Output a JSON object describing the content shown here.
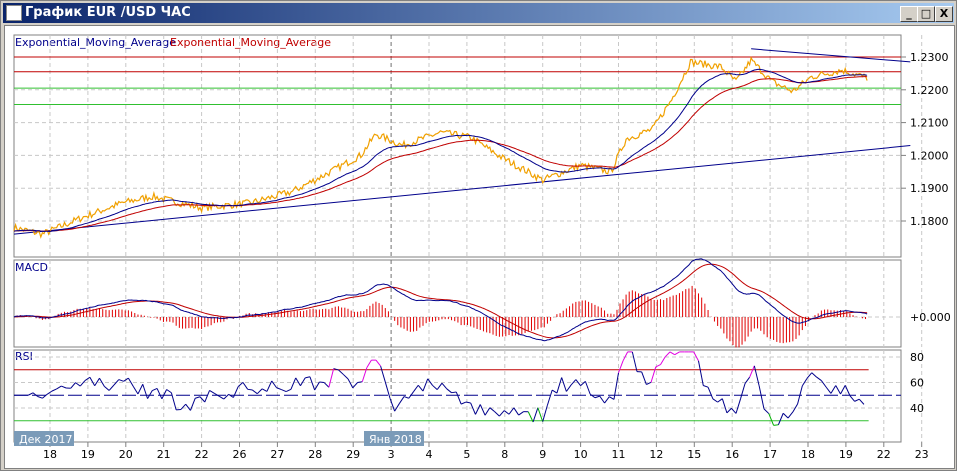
{
  "window": {
    "title": "График EUR /USD  ЧАС",
    "minimize": "_",
    "maximize": "□",
    "close": "X"
  },
  "legend": {
    "ema1": "Exponential_Moving_Average",
    "ema2": "Exponential_Moving_Average",
    "ema1_color": "#00008b",
    "ema2_color": "#c00000"
  },
  "macd_label": "MACD",
  "rsi_label": "RSI",
  "month_labels": [
    "Дек 2017",
    "Янв 2018"
  ],
  "chart_data": [
    {
      "type": "line",
      "name": "price",
      "title": "EUR/USD H1",
      "color": "#f0a000",
      "x_ticks": [
        "18",
        "19",
        "20",
        "21",
        "22",
        "26",
        "27",
        "28",
        "29",
        "3",
        "4",
        "5",
        "8",
        "9",
        "10",
        "11",
        "12",
        "15",
        "16",
        "17",
        "18",
        "19",
        "22",
        "23"
      ],
      "y_ticks": [
        "1.2300",
        "1.2200",
        "1.2100",
        "1.2000",
        "1.1900",
        "1.1800"
      ],
      "ylim": [
        1.1735,
        1.2345
      ],
      "keypoints": [
        [
          -0.95,
          1.178
        ],
        [
          -0.2,
          1.176
        ],
        [
          0.84,
          1.181
        ],
        [
          1.9,
          1.1855
        ],
        [
          2.7,
          1.1875
        ],
        [
          4.0,
          1.184
        ],
        [
          5.3,
          1.1855
        ],
        [
          6.4,
          1.189
        ],
        [
          7.4,
          1.195
        ],
        [
          8.2,
          1.2
        ],
        [
          8.6,
          1.2065
        ],
        [
          9.3,
          1.203
        ],
        [
          10.3,
          1.207
        ],
        [
          11.1,
          1.2055
        ],
        [
          11.9,
          1.1995
        ],
        [
          13.0,
          1.1925
        ],
        [
          14.0,
          1.197
        ],
        [
          14.8,
          1.195
        ],
        [
          15.2,
          1.205
        ],
        [
          15.9,
          1.208
        ],
        [
          16.4,
          1.217
        ],
        [
          16.9,
          1.2285
        ],
        [
          17.7,
          1.227
        ],
        [
          18.1,
          1.2225
        ],
        [
          18.5,
          1.229
        ],
        [
          19.05,
          1.2225
        ],
        [
          19.6,
          1.2195
        ],
        [
          20.1,
          1.224
        ],
        [
          20.9,
          1.226
        ],
        [
          21.6,
          1.2235
        ]
      ],
      "hlines": [
        {
          "value": 1.23,
          "color": "#c00000"
        },
        {
          "value": 1.2255,
          "color": "#c00000"
        },
        {
          "value": 1.2205,
          "color": "#30c030"
        },
        {
          "value": 1.2155,
          "color": "#30c030"
        }
      ],
      "trendlines": [
        {
          "from": [
            -0.95,
            1.176
          ],
          "to": [
            22.7,
            1.203
          ],
          "color": "#00008b"
        },
        {
          "from": [
            18.5,
            1.2325
          ],
          "to": [
            22.7,
            1.2285
          ],
          "color": "#00008b"
        }
      ]
    },
    {
      "type": "bar",
      "name": "MACD",
      "y_ticks": [
        "+0.000"
      ]
    },
    {
      "type": "line",
      "name": "RSI",
      "y_ticks": [
        "80",
        "60",
        "40"
      ],
      "ylim": [
        16,
        86
      ],
      "levels": [
        {
          "value": 70,
          "color": "#c00000"
        },
        {
          "value": 30,
          "color": "#30c030"
        },
        {
          "value": 50,
          "color": "#00008b"
        }
      ]
    }
  ]
}
